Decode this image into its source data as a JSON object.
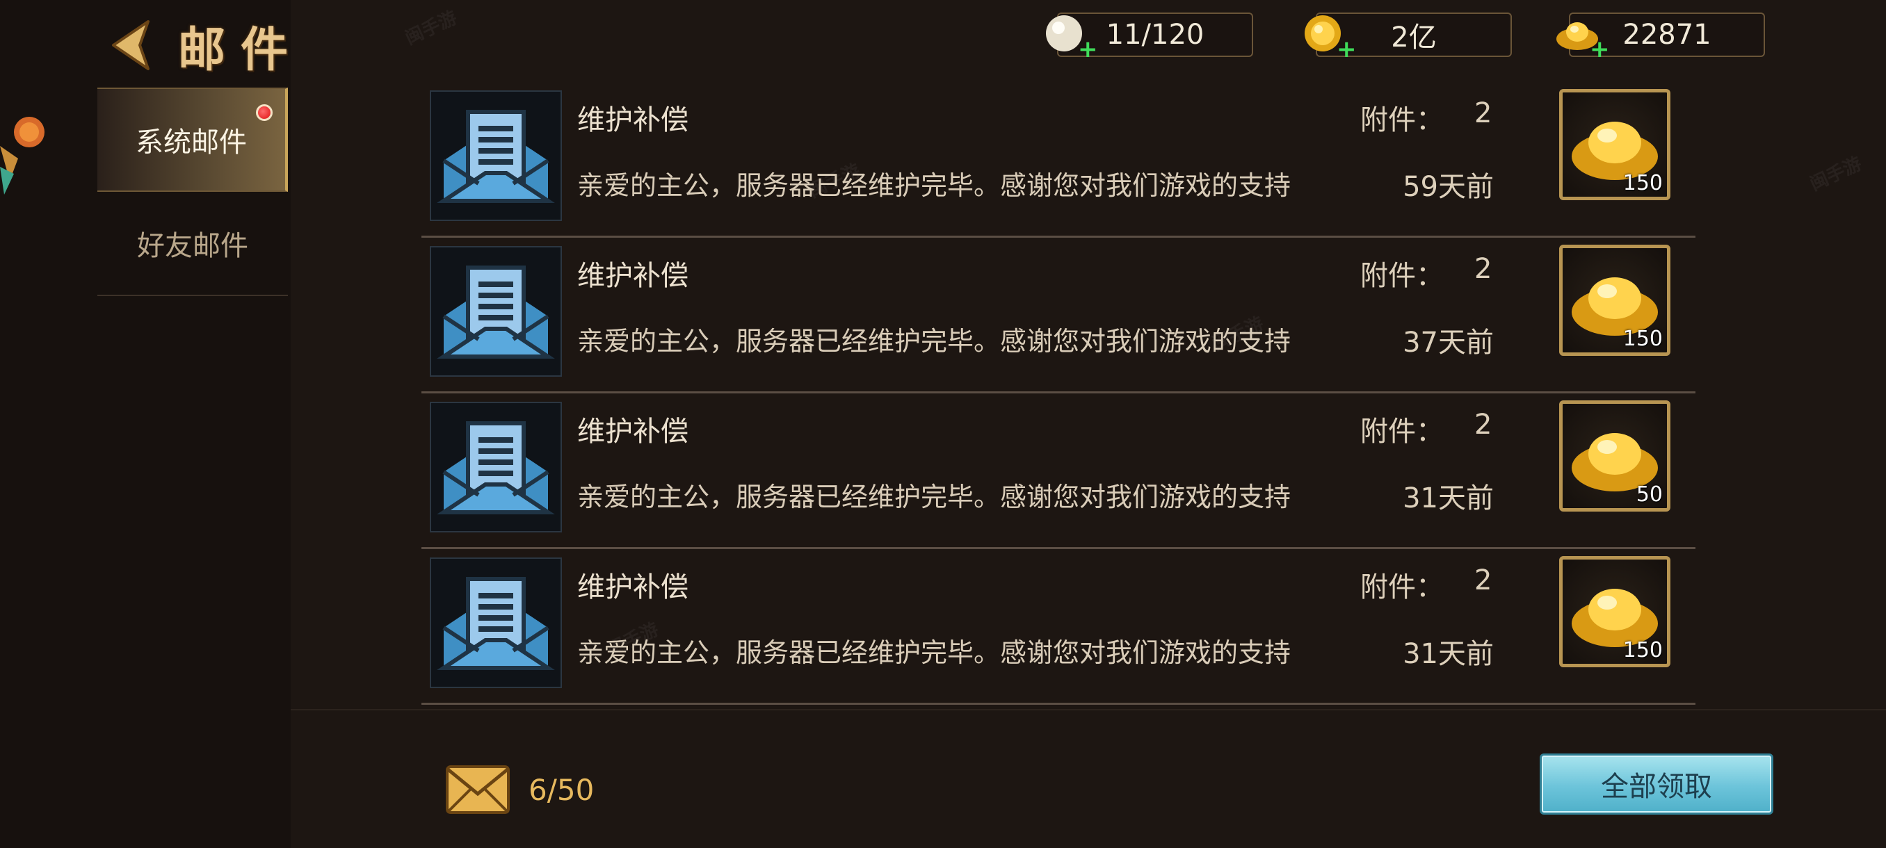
{
  "header": {
    "title": "邮件"
  },
  "tabs": [
    {
      "label": "系统邮件",
      "active": true,
      "has_notification": true
    },
    {
      "label": "好友邮件",
      "active": false,
      "has_notification": false
    }
  ],
  "resources": [
    {
      "icon": "pearl-icon",
      "value": "11/120"
    },
    {
      "icon": "gold-coin-icon",
      "value": "2亿"
    },
    {
      "icon": "gold-ingot-icon",
      "value": "22871"
    }
  ],
  "mails": [
    {
      "subject": "维护补偿",
      "body": "亲爱的主公，服务器已经维护完毕。感谢您对我们游戏的支持",
      "attachment_label": "附件：",
      "attachment_count": "2",
      "time": "59天前",
      "reward_qty": "150"
    },
    {
      "subject": "维护补偿",
      "body": "亲爱的主公，服务器已经维护完毕。感谢您对我们游戏的支持",
      "attachment_label": "附件：",
      "attachment_count": "2",
      "time": "37天前",
      "reward_qty": "150"
    },
    {
      "subject": "维护补偿",
      "body": "亲爱的主公，服务器已经维护完毕。感谢您对我们游戏的支持",
      "attachment_label": "附件：",
      "attachment_count": "2",
      "time": "31天前",
      "reward_qty": "50"
    },
    {
      "subject": "维护补偿",
      "body": "亲爱的主公，服务器已经维护完毕。感谢您对我们游戏的支持",
      "attachment_label": "附件：",
      "attachment_count": "2",
      "time": "31天前",
      "reward_qty": "150"
    }
  ],
  "footer": {
    "mailbox_count": "6/50",
    "collect_all_label": "全部领取"
  },
  "colors": {
    "accent_gold": "#e8c68e",
    "button_cyan": "#6cc4da",
    "notification_red": "#dd1111"
  }
}
